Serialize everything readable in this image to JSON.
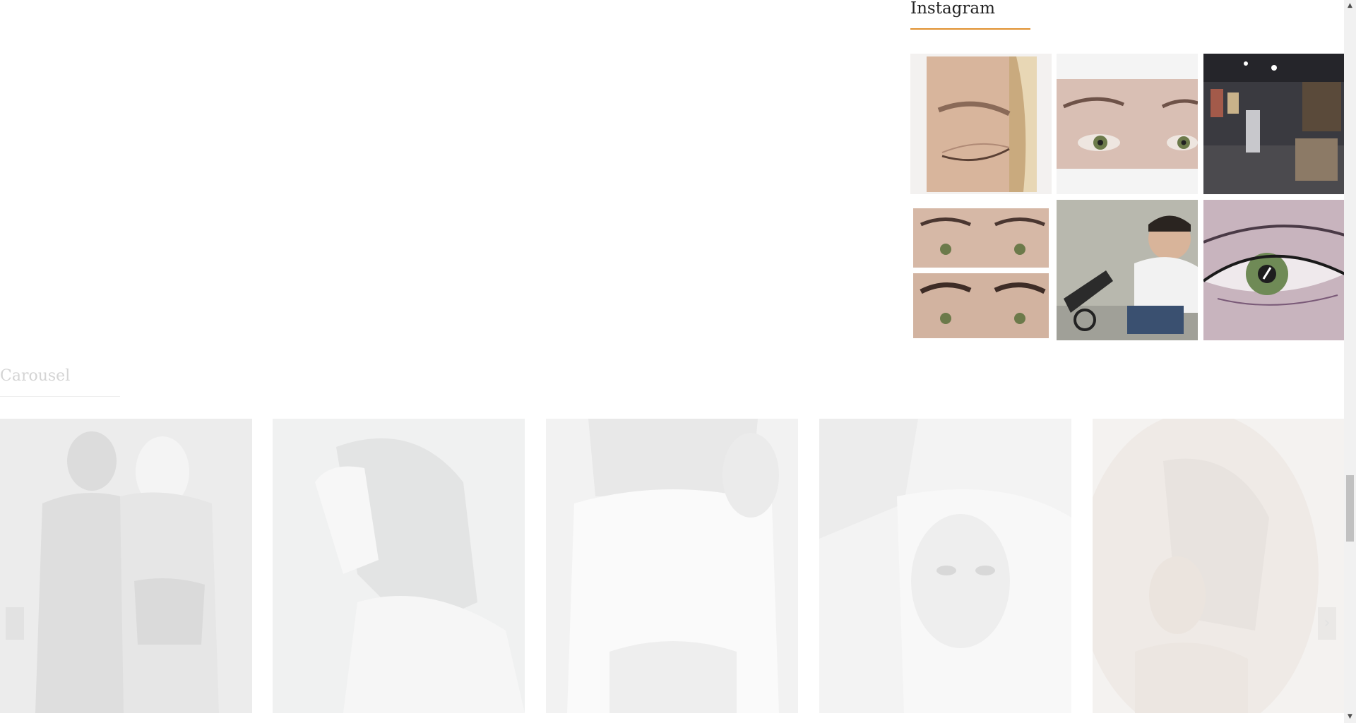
{
  "instagram": {
    "title": "Instagram",
    "accent": "#e0902e",
    "photos": [
      {
        "alt": "closed eye with eyebrow tattoo"
      },
      {
        "alt": "green eyes with microbladed brows"
      },
      {
        "alt": "tattoo studio interior"
      },
      {
        "alt": "eyebrows before and after"
      },
      {
        "alt": "tattoo artist selfie"
      },
      {
        "alt": "green eye with eyeliner tattoo"
      }
    ]
  },
  "carousel": {
    "title": "Carousel",
    "prev_icon": "chevron-left-icon",
    "next_icon": "chevron-right-icon",
    "prev_glyph": "‹",
    "next_glyph": "›",
    "slides": [
      {
        "alt": "tattooed couple"
      },
      {
        "alt": "woman with dark hair"
      },
      {
        "alt": "woman with shoulder tattoo"
      },
      {
        "alt": "blonde woman portrait"
      },
      {
        "alt": "back tattoo artwork"
      }
    ]
  },
  "scrollbar": {
    "up_glyph": "▲",
    "down_glyph": "▼"
  }
}
